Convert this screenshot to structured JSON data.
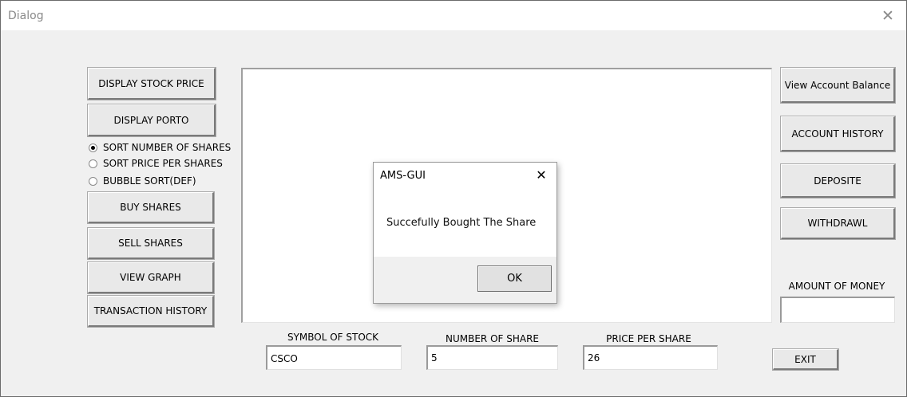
{
  "window": {
    "title": "Dialog",
    "close_glyph": "✕"
  },
  "left_buttons": {
    "display_stock_price": "DISPLAY STOCK PRICE",
    "display_porto": "DISPLAY PORTO",
    "buy_shares": "BUY SHARES",
    "sell_shares": "SELL SHARES",
    "view_graph": "VIEW GRAPH",
    "transaction_history": "TRANSACTION HISTORY"
  },
  "sort_options": {
    "selected": "SORT NUMBER OF SHARES",
    "items": [
      "SORT NUMBER OF SHARES",
      "SORT PRICE PER SHARES",
      "BUBBLE SORT(DEF)"
    ]
  },
  "right_buttons": {
    "view_account_balance": "View Account Balance",
    "account_history": "ACCOUNT HISTORY",
    "deposite": "DEPOSITE",
    "withdrawl": "WITHDRAWL",
    "exit": "EXIT"
  },
  "amount": {
    "label": "AMOUNT OF MONEY",
    "value": ""
  },
  "fields": {
    "symbol_label": "SYMBOL OF STOCK",
    "symbol_value": "CSCO",
    "number_label": "NUMBER OF SHARE",
    "number_value": "5",
    "price_label": "PRICE PER SHARE",
    "price_value": "26"
  },
  "message_box": {
    "title": "AMS-GUI",
    "message": "Succefully Bought The Share",
    "ok_label": "OK",
    "close_glyph": "✕"
  },
  "icons": {
    "window_close": "close-icon",
    "msgbox_close": "close-icon"
  }
}
